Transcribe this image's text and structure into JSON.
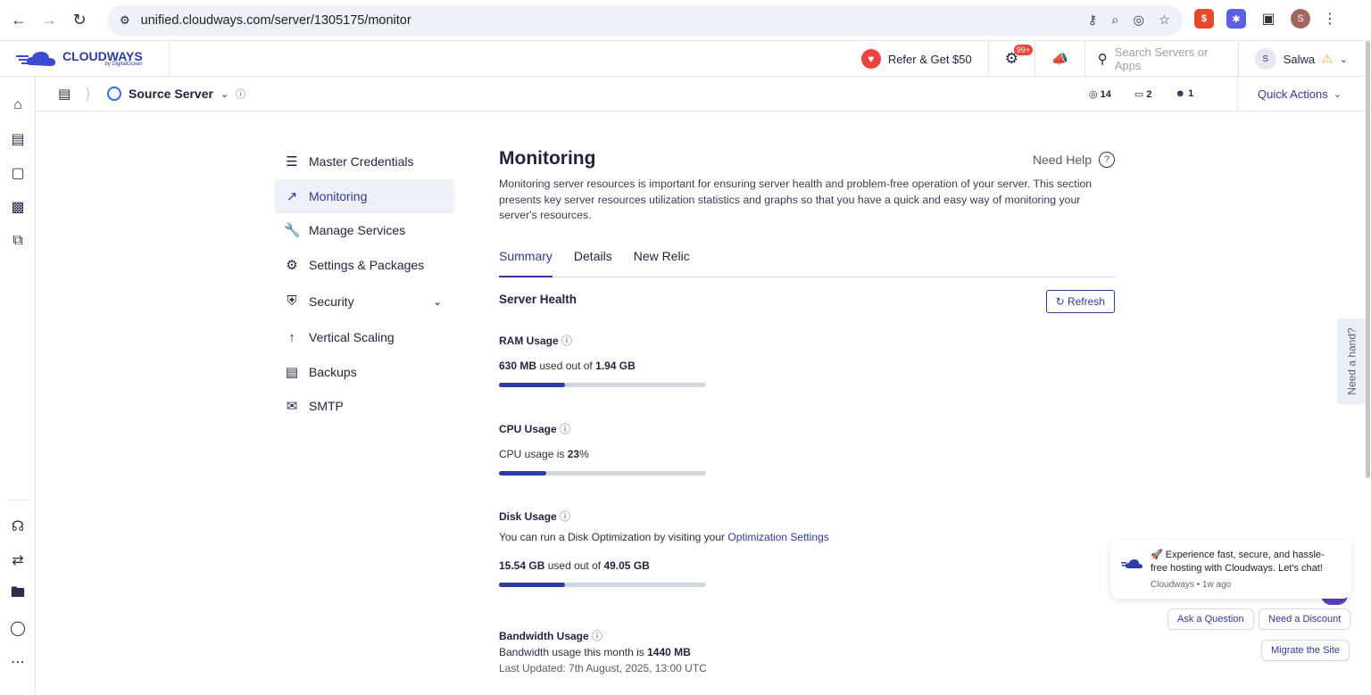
{
  "browser": {
    "url": "unified.cloudways.com/server/1305175/monitor",
    "profile_initial": "S"
  },
  "header": {
    "logo_text": "CLOUDWAYS",
    "logo_sub": "by DigitalOcean",
    "refer_label": "Refer & Get $50",
    "notif_badge": "99+",
    "search_placeholder": "Search Servers or Apps",
    "user_initial": "S",
    "user_name": "Salwa"
  },
  "breadcrumb": {
    "server_name": "Source Server",
    "stats": [
      {
        "icon": "www-icon",
        "value": "14"
      },
      {
        "icon": "folder-icon",
        "value": "2"
      },
      {
        "icon": "user-icon",
        "value": "1"
      }
    ],
    "quick_actions": "Quick Actions"
  },
  "menu": {
    "items": [
      {
        "label": "Master Credentials",
        "icon": "list-icon"
      },
      {
        "label": "Monitoring",
        "icon": "chart-icon"
      },
      {
        "label": "Manage Services",
        "icon": "wrench-icon"
      },
      {
        "label": "Settings & Packages",
        "icon": "gear-icon"
      },
      {
        "label": "Security",
        "icon": "shield-icon"
      },
      {
        "label": "Vertical Scaling",
        "icon": "arrow-up-icon"
      },
      {
        "label": "Backups",
        "icon": "backup-icon"
      },
      {
        "label": "SMTP",
        "icon": "mail-icon"
      }
    ]
  },
  "main": {
    "title": "Monitoring",
    "need_help": "Need Help",
    "description": "Monitoring server resources is important for ensuring server health and problem-free operation of your server. This section presents key server resources utilization statistics and graphs so that you have a quick and easy way of monitoring your server's resources.",
    "tabs": [
      "Summary",
      "Details",
      "New Relic"
    ],
    "section_title": "Server Health",
    "refresh_label": "Refresh",
    "ram": {
      "label": "RAM Usage",
      "used": "630 MB",
      "mid": "used out of",
      "total": "1.94 GB",
      "fraction": 0.32
    },
    "cpu": {
      "label": "CPU Usage",
      "prefix": "CPU usage is",
      "value": "23",
      "suffix": "%",
      "fraction": 0.23
    },
    "disk": {
      "label": "Disk Usage",
      "hint": "You can run a Disk Optimization by visiting your",
      "hint_link": "Optimization Settings",
      "used": "15.54 GB",
      "mid": "used out of",
      "total": "49.05 GB",
      "fraction": 0.32
    },
    "bandwidth": {
      "label": "Bandwidth Usage",
      "prefix": "Bandwidth usage this month is",
      "value": "1440 MB",
      "updated": "Last Updated: 7th August, 2025, 13:00 UTC"
    }
  },
  "side_tab": "Need a hand?",
  "chat": {
    "message": "🚀 Experience fast, secure, and hassle-free hosting with Cloudways. Let's chat!",
    "meta": "Cloudways • 1w ago",
    "btn_question": "Ask a Question",
    "btn_discount": "Need a Discount",
    "btn_migrate": "Migrate the Site"
  },
  "colors": {
    "accent": "#2e3aa5",
    "danger": "#e8453c"
  }
}
